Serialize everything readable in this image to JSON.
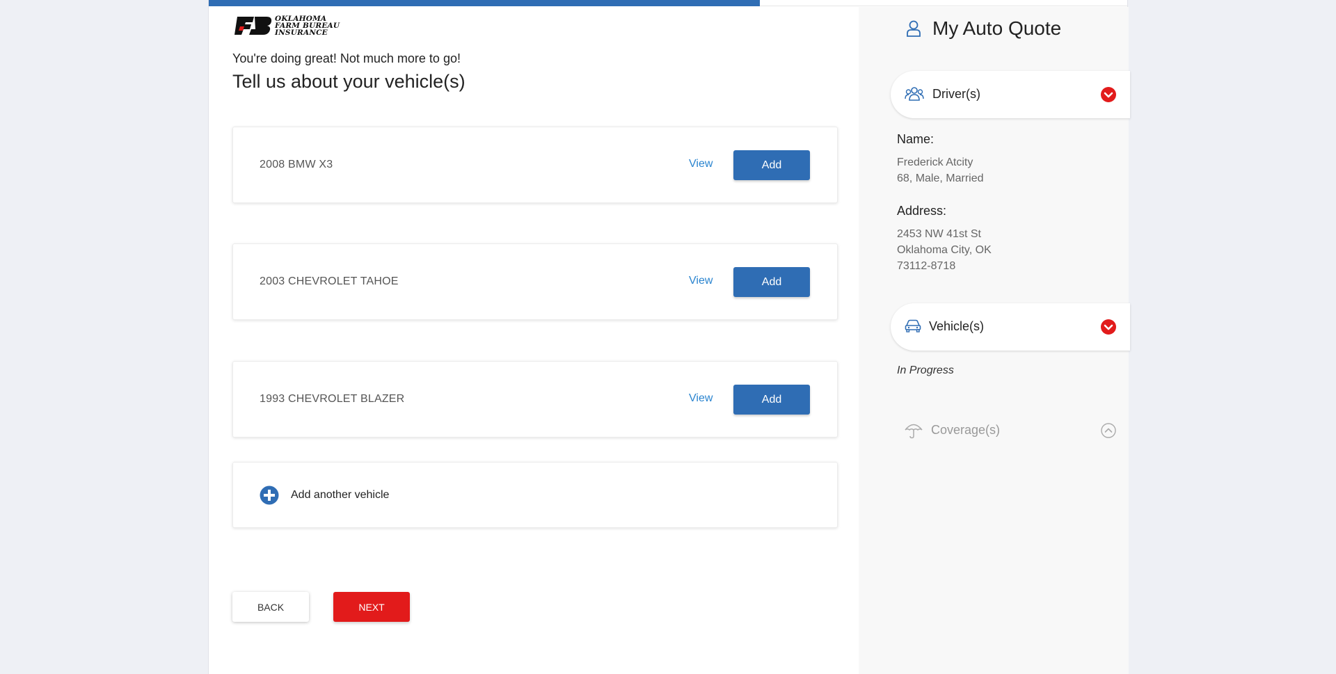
{
  "header": {
    "progress_percent": 60,
    "logo": {
      "line1": "OKLAHOMA",
      "line2": "FARM BUREAU",
      "line3": "INSURANCE"
    }
  },
  "main": {
    "subtitle": "You're doing great! Not much more to go!",
    "title": "Tell us about your vehicle(s)",
    "vehicles": [
      {
        "name": "2008 BMW X3",
        "view_label": "View",
        "add_label": "Add"
      },
      {
        "name": "2003 CHEVROLET TAHOE",
        "view_label": "View",
        "add_label": "Add"
      },
      {
        "name": "1993 CHEVROLET BLAZER",
        "view_label": "View",
        "add_label": "Add"
      }
    ],
    "add_another_label": "Add another vehicle",
    "back_label": "BACK",
    "next_label": "NEXT"
  },
  "sidebar": {
    "title": "My Auto Quote",
    "drivers": {
      "label": "Driver(s)",
      "name_label": "Name:",
      "name_value": "Frederick Atcity",
      "name_details": "68, Male, Married",
      "address_label": "Address:",
      "address_line1": "2453 NW 41st St",
      "address_line2": "Oklahoma City, OK",
      "address_line3": "73112-8718"
    },
    "vehicles": {
      "label": "Vehicle(s)",
      "status": "In Progress"
    },
    "coverages": {
      "label": "Coverage(s)"
    }
  },
  "colors": {
    "primary_blue": "#2f6db4",
    "link_blue": "#2a84cf",
    "accent_red": "#e21b1b",
    "sidebar_bg": "#f8f8f8",
    "page_bg": "#eef0f5"
  },
  "icons": {
    "user": "user-icon",
    "drivers": "people-icon",
    "vehicles": "car-icon",
    "coverages": "umbrella-icon",
    "expand": "chevron-down-icon",
    "collapse": "chevron-up-icon",
    "add": "plus-circle-icon"
  }
}
